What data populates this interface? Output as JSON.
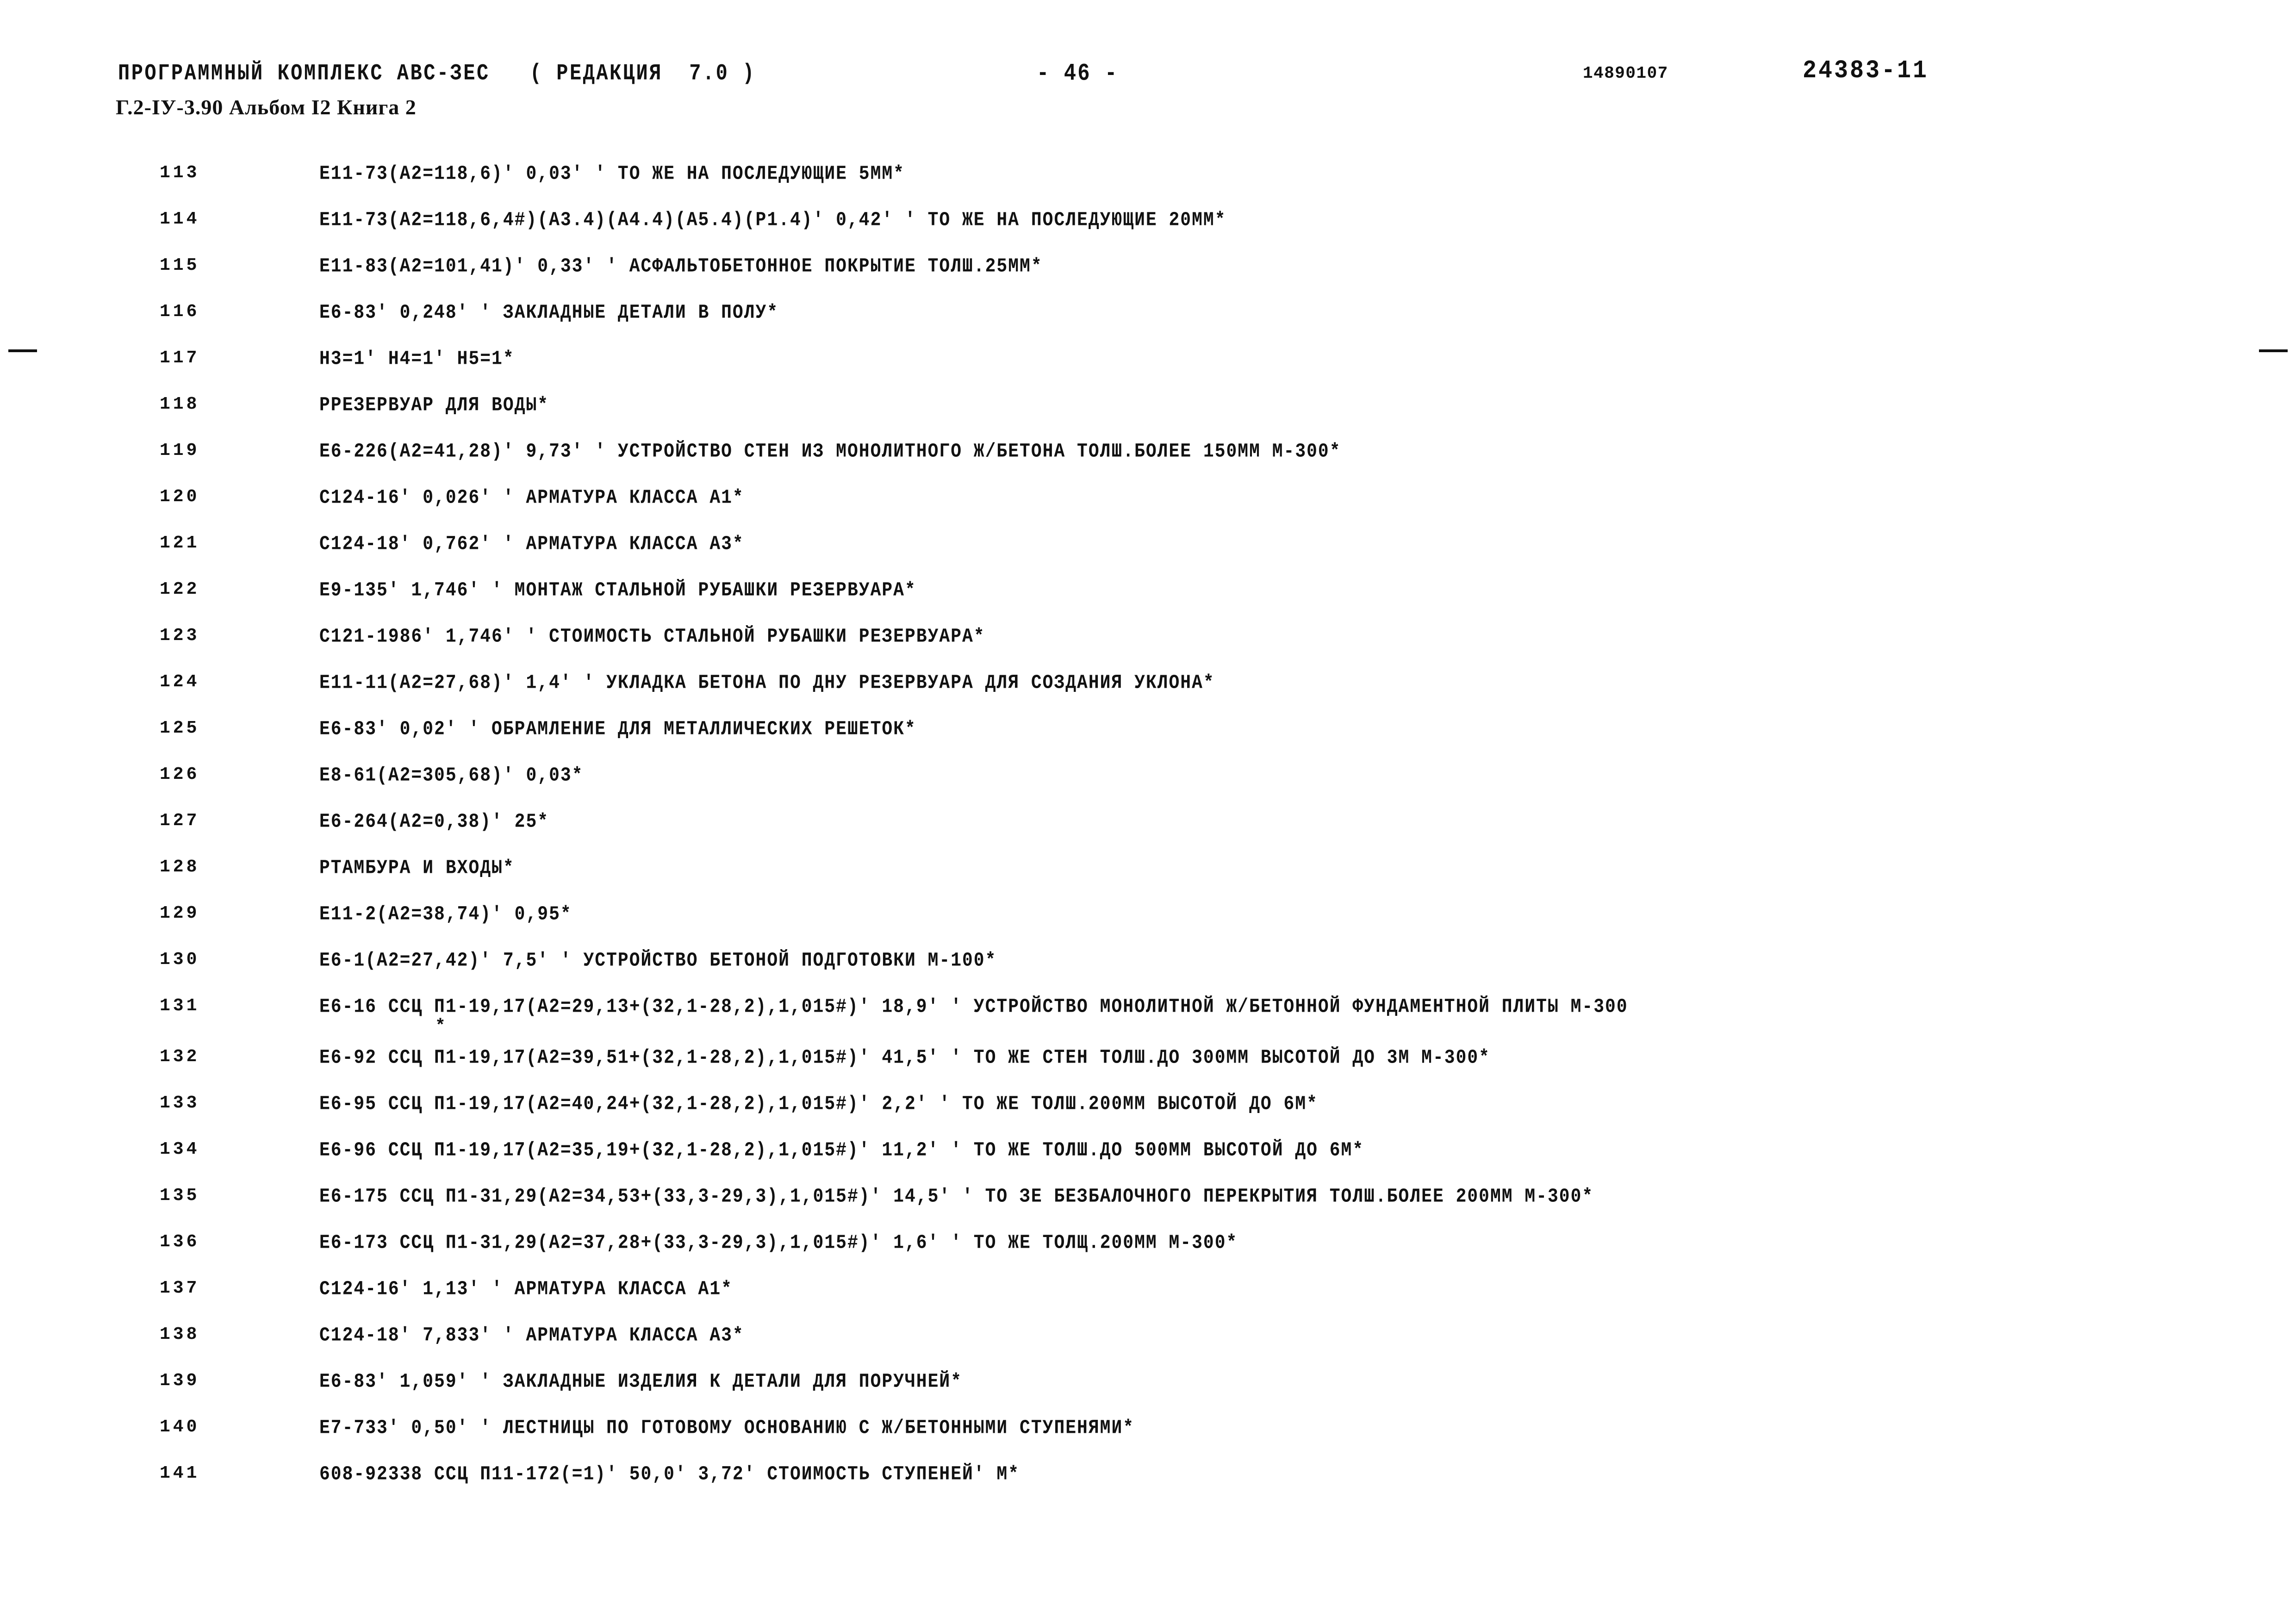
{
  "header": {
    "program_line": "ПРОГРАММНЫЙ КОМПЛЕКС АВС-ЗЕС   ( РЕДАКЦИЯ  7.0 )",
    "page_marker": "- 46 -",
    "left_code": "14890107",
    "doc_number": "24383-11",
    "album_line": "Г.2-IУ-3.90 Альбом I2 Книга 2"
  },
  "listing": {
    "rows": [
      {
        "num": "113",
        "text": "Е11-73(А2=118,6)' 0,03' ' ТО ЖЕ НА ПОСЛЕДУЮЩИЕ 5ММ*"
      },
      {
        "num": "114",
        "text": "Е11-73(А2=118,6,4#)(А3.4)(А4.4)(А5.4)(Р1.4)' 0,42' ' ТО ЖЕ НА ПОСЛЕДУЮЩИЕ 20ММ*"
      },
      {
        "num": "115",
        "text": "Е11-83(А2=101,41)' 0,33' ' АСФАЛЬТОБЕТОННОЕ ПОКРЫТИЕ ТОЛШ.25ММ*"
      },
      {
        "num": "116",
        "text": "Е6-83' 0,248' ' ЗАКЛАДНЫЕ ДЕТАЛИ В ПОЛУ*"
      },
      {
        "num": "117",
        "text": "Н3=1' Н4=1' Н5=1*"
      },
      {
        "num": "118",
        "text": "РРЕЗЕРВУАР ДЛЯ ВОДЫ*"
      },
      {
        "num": "119",
        "text": "Е6-226(А2=41,28)' 9,73' ' УСТРОЙСТВО СТЕН ИЗ МОНОЛИТНОГО Ж/БЕТОНА ТОЛШ.БОЛЕЕ 150ММ М-300*"
      },
      {
        "num": "120",
        "text": "С124-16' 0,026' ' АРМАТУРА КЛАССА А1*"
      },
      {
        "num": "121",
        "text": "С124-18' 0,762' ' АРМАТУРА КЛАССА А3*"
      },
      {
        "num": "122",
        "text": "Е9-135' 1,746' ' МОНТАЖ СТАЛЬНОЙ РУБАШКИ РЕЗЕРВУАРА*"
      },
      {
        "num": "123",
        "text": "С121-1986' 1,746' ' СТОИМОСТЬ СТАЛЬНОЙ РУБАШКИ РЕЗЕРВУАРА*"
      },
      {
        "num": "124",
        "text": "Е11-11(А2=27,68)' 1,4' ' УКЛАДКА БЕТОНА ПО ДНУ РЕЗЕРВУАРА ДЛЯ СОЗДАНИЯ УКЛОНА*"
      },
      {
        "num": "125",
        "text": "Е6-83' 0,02' ' ОБРАМЛЕНИЕ ДЛЯ МЕТАЛЛИЧЕСКИХ РЕШЕТОК*"
      },
      {
        "num": "126",
        "text": "Е8-61(А2=305,68)' 0,03*"
      },
      {
        "num": "127",
        "text": "Е6-264(А2=0,38)' 25*"
      },
      {
        "num": "128",
        "text": "РТАМБУРА И ВХОДЫ*"
      },
      {
        "num": "129",
        "text": "Е11-2(А2=38,74)' 0,95*"
      },
      {
        "num": "130",
        "text": "Е6-1(А2=27,42)' 7,5' ' УСТРОЙСТВО БЕТОНОЙ ПОДГОТОВКИ М-100*"
      },
      {
        "num": "131",
        "text": "Е6-16 ССЦ П1-19,17(А2=29,13+(32,1-28,2),1,015#)' 18,9' ' УСТРОЙСТВО МОНОЛИТНОЙ Ж/БЕТОННОЙ ФУНДАМЕНТНОЙ ПЛИТЫ М-300",
        "continuation": "*"
      },
      {
        "num": "132",
        "text": "Е6-92 ССЦ П1-19,17(А2=39,51+(32,1-28,2),1,015#)' 41,5' ' ТО ЖЕ СТЕН ТОЛШ.ДО 300ММ ВЫСОТОЙ ДО 3М М-300*"
      },
      {
        "num": "133",
        "text": "Е6-95 ССЦ П1-19,17(А2=40,24+(32,1-28,2),1,015#)' 2,2' ' ТО ЖЕ ТОЛШ.200ММ ВЫСОТОЙ ДО 6М*"
      },
      {
        "num": "134",
        "text": "Е6-96 ССЦ П1-19,17(А2=35,19+(32,1-28,2),1,015#)' 11,2' ' ТО ЖЕ ТОЛШ.ДО 500ММ ВЫСОТОЙ ДО 6М*"
      },
      {
        "num": "135",
        "text": "Е6-175 ССЦ П1-31,29(А2=34,53+(33,3-29,3),1,015#)' 14,5' ' ТО ЗЕ БЕЗБАЛОЧНОГО ПЕРЕКРЫТИЯ ТОЛШ.БОЛЕЕ 200ММ М-300*"
      },
      {
        "num": "136",
        "text": "Е6-173 ССЦ П1-31,29(А2=37,28+(33,3-29,3),1,015#)' 1,6' ' ТО ЖЕ ТОЛЩ.200ММ М-300*"
      },
      {
        "num": "137",
        "text": "С124-16' 1,13' ' АРМАТУРА КЛАССА А1*"
      },
      {
        "num": "138",
        "text": "С124-18' 7,833' ' АРМАТУРА КЛАССА А3*"
      },
      {
        "num": "139",
        "text": "Е6-83' 1,059' ' ЗАКЛАДНЫЕ ИЗДЕЛИЯ К ДЕТАЛИ ДЛЯ ПОРУЧНЕЙ*"
      },
      {
        "num": "140",
        "text": "Е7-733' 0,50' ' ЛЕСТНИЦЫ ПО ГОТОВОМУ ОСНОВАНИЮ С Ж/БЕТОННЫМИ СТУПЕНЯМИ*"
      },
      {
        "num": "141",
        "text": "608-92338 ССЦ П11-172(=1)' 50,0' 3,72' СТОИМОСТЬ СТУПЕНЕЙ' М*"
      }
    ]
  }
}
